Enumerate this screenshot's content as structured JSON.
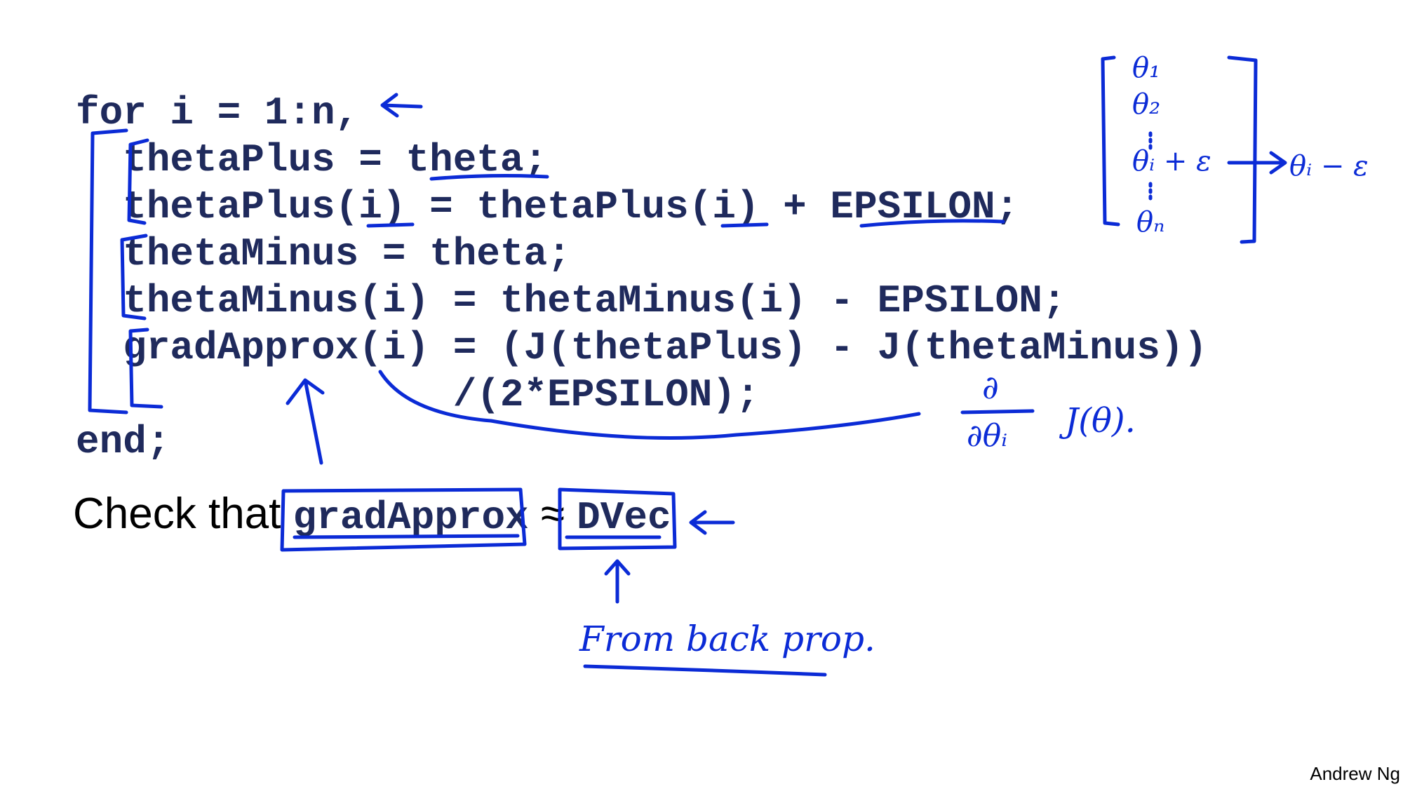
{
  "code": {
    "lines": [
      "for i = 1:n,",
      "  thetaPlus = theta;",
      "  thetaPlus(i) = thetaPlus(i) + EPSILON;",
      "  thetaMinus = theta;",
      "  thetaMinus(i) = thetaMinus(i) - EPSILON;",
      "  gradApprox(i) = (J(thetaPlus) - J(thetaMinus))",
      "                /(2*EPSILON);",
      "end;"
    ]
  },
  "check": {
    "prefix": "Check that ",
    "left_var": "gradApprox",
    "approx_symbol": "≈",
    "right_var": "DVec"
  },
  "annotations": {
    "backprop_note": "From back prop.",
    "derivative_numerator": "∂",
    "derivative_denominator": "∂θᵢ",
    "derivative_function": "J(θ).",
    "vector_entries": [
      "θ₁",
      "θ₂",
      "θᵢ + ε",
      "θₙ"
    ],
    "vector_minus": "θᵢ − ε"
  },
  "footer": {
    "author": "Andrew Ng"
  },
  "colors": {
    "code": "#1f2a5c",
    "ink": "#0b2bd6",
    "text": "#000000"
  }
}
